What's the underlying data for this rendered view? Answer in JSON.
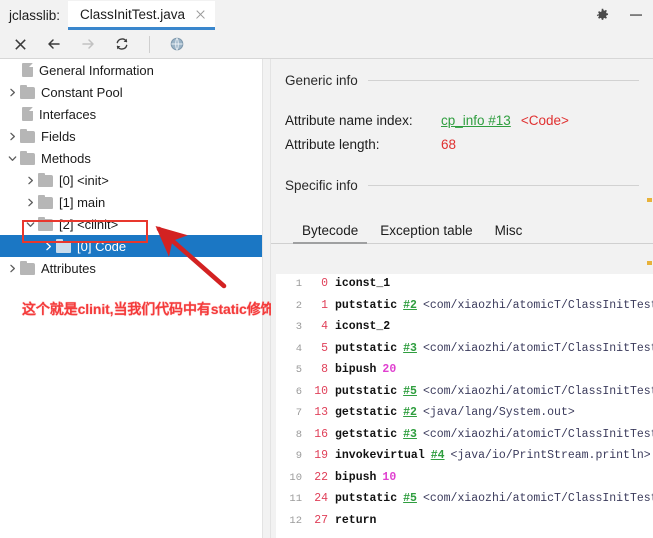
{
  "window": {
    "app_label": "jclasslib:",
    "tab_title": "ClassInitTest.java",
    "close_tab_icon": "close-icon",
    "settings_icon": "gear-icon",
    "minimize_icon": "minimize-icon"
  },
  "toolbar": {
    "buttons": [
      {
        "name": "close-icon",
        "title": "Close"
      },
      {
        "name": "back-icon",
        "title": "Back"
      },
      {
        "name": "forward-icon",
        "title": "Forward"
      },
      {
        "name": "reload-icon",
        "title": "Reload"
      },
      {
        "name": "browse-icon",
        "title": "Browse"
      }
    ]
  },
  "tree": {
    "items": [
      {
        "label": "General Information",
        "indent": 0,
        "twisty": "none",
        "icon": "document"
      },
      {
        "label": "Constant Pool",
        "indent": 0,
        "twisty": "collapsed",
        "icon": "folder"
      },
      {
        "label": "Interfaces",
        "indent": 0,
        "twisty": "none",
        "icon": "document"
      },
      {
        "label": "Fields",
        "indent": 0,
        "twisty": "collapsed",
        "icon": "folder"
      },
      {
        "label": "Methods",
        "indent": 0,
        "twisty": "expanded",
        "icon": "folder"
      },
      {
        "label": "[0] <init>",
        "indent": 1,
        "twisty": "collapsed",
        "icon": "folder"
      },
      {
        "label": "[1] main",
        "indent": 1,
        "twisty": "collapsed",
        "icon": "folder"
      },
      {
        "label": "[2] <clinit>",
        "indent": 1,
        "twisty": "expanded",
        "icon": "folder"
      },
      {
        "label": "[0] Code",
        "indent": 2,
        "twisty": "collapsed",
        "icon": "folder",
        "selected": true
      },
      {
        "label": "Attributes",
        "indent": 0,
        "twisty": "collapsed",
        "icon": "folder"
      }
    ]
  },
  "annotation": {
    "text": "这个就是clinit,当我们代码中有static修饰的变量或者代码快时会出现",
    "color": "#f43b3b",
    "highlight_box_color": "#e8372d",
    "arrow_color": "#d32222"
  },
  "detail": {
    "generic_info": {
      "title": "Generic info",
      "attribute_name_index_label": "Attribute name index:",
      "attribute_name_index_link": "cp_info #13",
      "attribute_name_index_value": "<Code>",
      "attribute_length_label": "Attribute length:",
      "attribute_length_value": "68"
    },
    "specific_info": {
      "title": "Specific info",
      "tabs": [
        {
          "label": "Bytecode",
          "active": true
        },
        {
          "label": "Exception table",
          "active": false
        },
        {
          "label": "Misc",
          "active": false
        }
      ]
    },
    "bytecode": [
      {
        "line": "1",
        "offset": "0",
        "mnemonic": "iconst_1",
        "ref": "",
        "comment": ""
      },
      {
        "line": "2",
        "offset": "1",
        "mnemonic": "putstatic",
        "ref": "#2",
        "comment": "<com/xiaozhi/atomicT/ClassInitTest."
      },
      {
        "line": "3",
        "offset": "4",
        "mnemonic": "iconst_2",
        "ref": "",
        "comment": ""
      },
      {
        "line": "4",
        "offset": "5",
        "mnemonic": "putstatic",
        "ref": "#3",
        "comment": "<com/xiaozhi/atomicT/ClassInitTest."
      },
      {
        "line": "5",
        "offset": "8",
        "mnemonic": "bipush",
        "imm": "20",
        "ref": "",
        "comment": ""
      },
      {
        "line": "6",
        "offset": "10",
        "mnemonic": "putstatic",
        "ref": "#5",
        "comment": "<com/xiaozhi/atomicT/ClassInitTest."
      },
      {
        "line": "7",
        "offset": "13",
        "mnemonic": "getstatic",
        "ref": "#2",
        "comment": "<java/lang/System.out>"
      },
      {
        "line": "8",
        "offset": "16",
        "mnemonic": "getstatic",
        "ref": "#3",
        "comment": "<com/xiaozhi/atomicT/ClassInitTest."
      },
      {
        "line": "9",
        "offset": "19",
        "mnemonic": "invokevirtual",
        "ref": "#4",
        "comment": "<java/io/PrintStream.println>"
      },
      {
        "line": "10",
        "offset": "22",
        "mnemonic": "bipush",
        "imm": "10",
        "ref": "",
        "comment": ""
      },
      {
        "line": "11",
        "offset": "24",
        "mnemonic": "putstatic",
        "ref": "#5",
        "comment": "<com/xiaozhi/atomicT/ClassInitTest."
      },
      {
        "line": "12",
        "offset": "27",
        "mnemonic": "return",
        "ref": "",
        "comment": ""
      }
    ]
  }
}
